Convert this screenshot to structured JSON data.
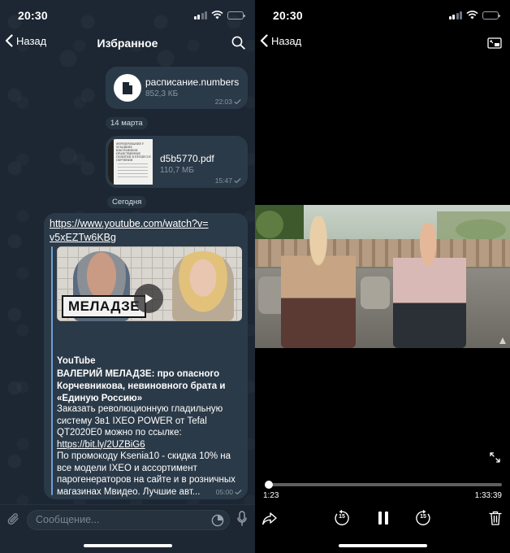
{
  "status": {
    "time_left": "20:30",
    "time_right": "20:30",
    "battery_fraction": 0.45,
    "battery_color": "#f5c400"
  },
  "chat": {
    "back_label": "Назад",
    "title": "Избранное",
    "messages": {
      "file1": {
        "name": "расписание.numbers",
        "size": "852,3 КБ",
        "time": "22:03"
      },
      "date1": "14 марта",
      "file2": {
        "name": "d5b5770.pdf",
        "size": "110,7 МБ",
        "time": "15:47",
        "thumb_text": "Формирование у младших школьников нравственных понятий в процессе обучения"
      },
      "date2": "Сегодня",
      "link_msg": {
        "url": "https://www.youtube.com/watch?v=v5xEZTw6KBg",
        "thumb_brand": "МЕЛАДЗЕ",
        "source": "YouTube",
        "title": "ВАЛЕРИЙ МЕЛАДЗЕ: про опасного Корчевникова, невиновного брата и «Единую Россию»",
        "desc_a": "Заказать революционную гладильную систему 3в1 IXEO POWER от Tefal QT2020E0 можно по ссылке: ",
        "desc_link": "https://bit.ly/2UZBiG6",
        "desc_b": "По промокоду Ksenia10 - скидка 10% на все модели IXEO и ассортимент парогенераторов на сайте и в розничных магазинах Мвидео. Лучшие авт...",
        "time": "05:00"
      }
    },
    "input_placeholder": "Сообщение..."
  },
  "player": {
    "back_label": "Назад",
    "current_time": "1:23",
    "duration": "1:33:39",
    "progress_fraction": 0.015,
    "skip_back": "15",
    "skip_forward": "15"
  },
  "colors": {
    "chat_bg": "#1c2733",
    "bubble": "#2b3a48",
    "accent_bar": "#6d9fd4"
  }
}
